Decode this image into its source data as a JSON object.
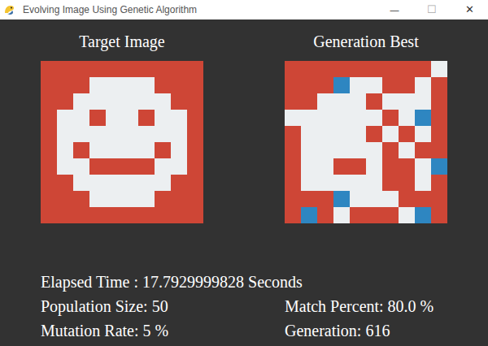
{
  "window": {
    "title": "Evolving Image Using Genetic Algorithm",
    "controls": [
      "—",
      "☐",
      "✕"
    ]
  },
  "palette": [
    "#ce4636",
    "#eceff1",
    "#2e86c1"
  ],
  "panels": [
    {
      "title": "Target Image",
      "grid": [
        [
          0,
          0,
          0,
          0,
          0,
          0,
          0,
          0,
          0,
          0
        ],
        [
          0,
          0,
          0,
          1,
          1,
          1,
          1,
          0,
          0,
          0
        ],
        [
          0,
          0,
          1,
          1,
          1,
          1,
          1,
          1,
          0,
          0
        ],
        [
          0,
          1,
          1,
          0,
          1,
          1,
          0,
          1,
          1,
          0
        ],
        [
          0,
          1,
          1,
          1,
          1,
          1,
          1,
          1,
          1,
          0
        ],
        [
          0,
          1,
          0,
          1,
          1,
          1,
          1,
          0,
          1,
          0
        ],
        [
          0,
          1,
          1,
          0,
          0,
          0,
          0,
          1,
          1,
          0
        ],
        [
          0,
          0,
          1,
          1,
          1,
          1,
          1,
          1,
          0,
          0
        ],
        [
          0,
          0,
          0,
          1,
          1,
          1,
          1,
          0,
          0,
          0
        ],
        [
          0,
          0,
          0,
          0,
          0,
          0,
          0,
          0,
          0,
          0
        ]
      ]
    },
    {
      "title": "Generation Best",
      "grid": [
        [
          0,
          0,
          0,
          0,
          0,
          0,
          0,
          0,
          0,
          1
        ],
        [
          0,
          0,
          0,
          2,
          1,
          1,
          0,
          0,
          1,
          0
        ],
        [
          0,
          0,
          1,
          1,
          1,
          0,
          1,
          1,
          1,
          0
        ],
        [
          1,
          1,
          1,
          1,
          1,
          1,
          0,
          1,
          2,
          0
        ],
        [
          0,
          1,
          1,
          1,
          1,
          0,
          1,
          0,
          1,
          0
        ],
        [
          0,
          1,
          1,
          1,
          1,
          1,
          0,
          1,
          0,
          0
        ],
        [
          0,
          1,
          1,
          0,
          0,
          1,
          0,
          0,
          1,
          2
        ],
        [
          0,
          1,
          1,
          1,
          1,
          1,
          0,
          0,
          1,
          0
        ],
        [
          0,
          0,
          0,
          2,
          1,
          1,
          1,
          0,
          0,
          0
        ],
        [
          0,
          2,
          0,
          1,
          0,
          0,
          0,
          1,
          2,
          0
        ]
      ]
    }
  ],
  "stats": {
    "elapsed": "Elapsed Time : 17.7929999828 Seconds",
    "rows": [
      [
        "Population Size: 50",
        "Match Percent: 80.0 %"
      ],
      [
        "Mutation Rate: 5 %",
        "Generation: 616"
      ]
    ]
  }
}
